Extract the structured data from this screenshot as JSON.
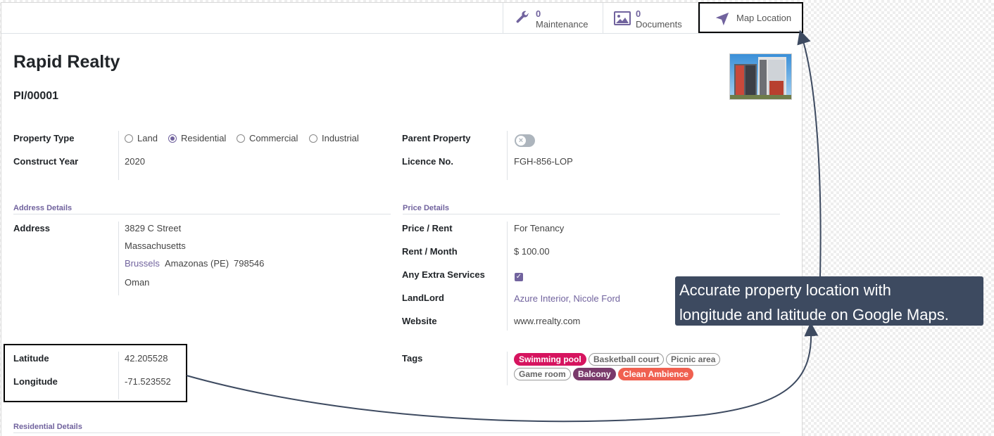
{
  "button_box": {
    "maintenance": {
      "count": "0",
      "label": "Maintenance"
    },
    "documents": {
      "count": "0",
      "label": "Documents"
    },
    "map_location": {
      "label": "Map Location"
    }
  },
  "record": {
    "name": "Rapid Realty",
    "reference": "PI/00001"
  },
  "fields": {
    "property_type": {
      "label": "Property Type",
      "options": [
        "Land",
        "Residential",
        "Commercial",
        "Industrial"
      ],
      "selected": "Residential"
    },
    "construct_year": {
      "label": "Construct Year",
      "value": "2020"
    },
    "parent_property": {
      "label": "Parent Property",
      "value": false
    },
    "licence_no": {
      "label": "Licence No.",
      "value": "FGH-856-LOP"
    }
  },
  "address_section": {
    "title": "Address Details",
    "label": "Address",
    "street": "3829 C Street",
    "state_line": "Massachusetts",
    "city": "Brussels",
    "state": "Amazonas (PE)",
    "zip": "798546",
    "country": "Oman"
  },
  "price_section": {
    "title": "Price Details",
    "price_rent": {
      "label": "Price / Rent",
      "value": "For Tenancy"
    },
    "rent_month": {
      "label": "Rent / Month",
      "value": "$ 100.00"
    },
    "extra_services": {
      "label": "Any Extra Services",
      "checked": true
    },
    "landlord": {
      "label": "LandLord",
      "value": "Azure Interior, Nicole Ford"
    },
    "website": {
      "label": "Website",
      "value": "www.rrealty.com"
    }
  },
  "geo": {
    "latitude": {
      "label": "Latitude",
      "value": "42.205528"
    },
    "longitude": {
      "label": "Longitude",
      "value": "-71.523552"
    }
  },
  "tags": {
    "label": "Tags",
    "items": [
      {
        "name": "Swimming pool",
        "style": "filled",
        "color": "#d6145f"
      },
      {
        "name": "Basketball court",
        "style": "outline",
        "color": "#999999"
      },
      {
        "name": "Picnic area",
        "style": "outline",
        "color": "#999999"
      },
      {
        "name": "Game room",
        "style": "outline",
        "color": "#999999"
      },
      {
        "name": "Balcony",
        "style": "filled",
        "color": "#7a3a6b"
      },
      {
        "name": "Clean Ambience",
        "style": "filled",
        "color": "#f06050"
      }
    ]
  },
  "residential_section": {
    "title": "Residential Details"
  },
  "callout": {
    "line1": "Accurate property location with",
    "line2": "longitude and latitude on Google Maps."
  },
  "colors": {
    "accent": "#71639e",
    "callout_bg": "#3d4a60",
    "arrow": "#3d4a60"
  }
}
